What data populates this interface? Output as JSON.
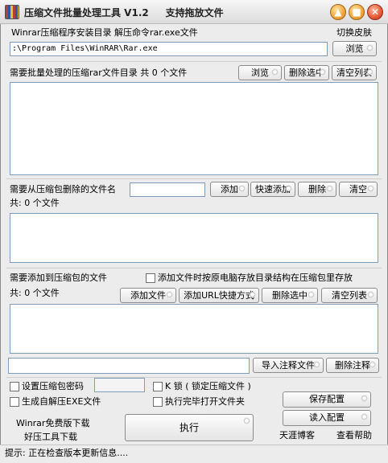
{
  "window": {
    "title": "压缩文件批量处理工具 V1.2     支持拖放文件",
    "min_glyph": "▲",
    "max_glyph": "■",
    "close_glyph": "✕"
  },
  "top": {
    "install_dir_label": "Winrar压缩程序安装目录 解压命令rar.exe文件",
    "skin_link": "切换皮肤",
    "path_value": ":\\Program Files\\WinRAR\\Rar.exe",
    "browse_label": "浏览"
  },
  "batch": {
    "label": "需要批量处理的压缩rar文件目录 共 0 个文件",
    "browse_label": "浏览",
    "delete_selected_label": "删除选中",
    "clear_list_label": "清空列表"
  },
  "remove": {
    "label": "需要从压缩包删除的文件名",
    "count_label": "共:  0 个文件",
    "input_value": "",
    "add_label": "添加",
    "quick_add_label": "快速添加",
    "delete_label": "删除",
    "clear_label": "清空"
  },
  "addfiles": {
    "label": "需要添加到压缩包的文件",
    "keep_structure_label": "添加文件时按原电脑存放目录结构在压缩包里存放",
    "count_label": "共:  0 个文件",
    "add_file_label": "添加文件",
    "add_url_label": "添加URL快捷方式",
    "delete_selected_label": "删除选中",
    "clear_list_label": "清空列表"
  },
  "comment": {
    "input_value": "",
    "import_label": "导入注释文件",
    "delete_label": "删除注释"
  },
  "options": {
    "password_label": "设置压缩包密码",
    "password_value": "",
    "lock_label": "K 锁 ( 锁定压缩文件 )",
    "sfx_label": "生成自解压EXE文件",
    "open_folder_label": "执行完毕打开文件夹"
  },
  "footer": {
    "winrar_download": "Winrar免费版下载",
    "tools_download": "好压工具下载",
    "execute_label": "执行",
    "save_config_label": "保存配置",
    "load_config_label": "读入配置",
    "blog_link": "天涯博客",
    "help_link": "查看帮助"
  },
  "status": {
    "text": "提示: 正在检查版本更新信息...."
  }
}
